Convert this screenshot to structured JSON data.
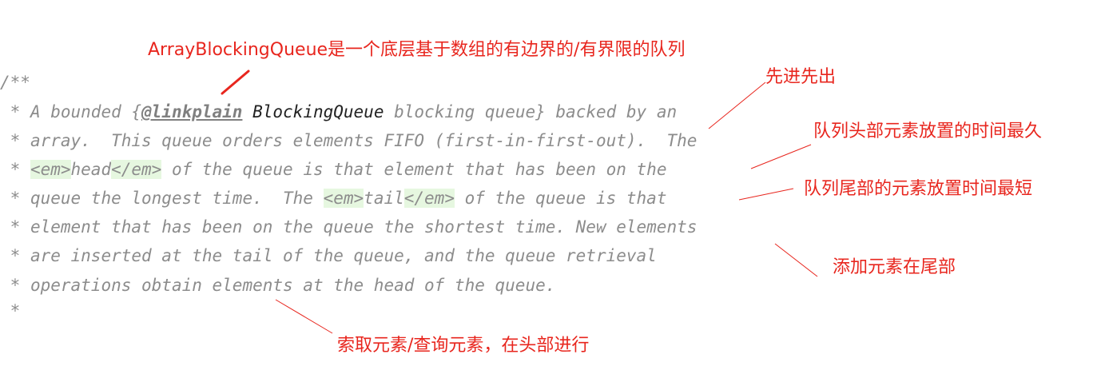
{
  "code": {
    "open": "/**",
    "prefix": " * ",
    "star_only": " *",
    "l1a": "A bounded {",
    "l1_linktag": "@linkplain",
    "l1_space": " ",
    "l1_ref": "BlockingQueue",
    "l1b": " blocking queue} backed by an",
    "l2": "array.  This queue orders elements FIFO (first-in-first-out).  The",
    "em_open": "<em>",
    "em_close": "</em>",
    "l3_word": "head",
    "l3b": " of the queue is that element that has been on the",
    "l4a": "queue the longest time.  The ",
    "l4_word": "tail",
    "l4b": " of the queue is that",
    "l5": "element that has been on the queue the shortest time. New elements",
    "l6": "are inserted at the tail of the queue, and the queue retrieval",
    "l7": "operations obtain elements at the head of the queue."
  },
  "annotations": {
    "title": "ArrayBlockingQueue是一个底层基于数组的有边界的/有界限的队列",
    "fifo": "先进先出",
    "head": "队列头部元素放置的时间最久",
    "tail": "队列尾部的元素放置时间最短",
    "insert": "添加元素在尾部",
    "retrieve": "索取元素/查询元素，在头部进行"
  },
  "colors": {
    "annotation": "#e8261e",
    "comment": "#8c8c8c",
    "tag_background": "#e6f7e0"
  }
}
